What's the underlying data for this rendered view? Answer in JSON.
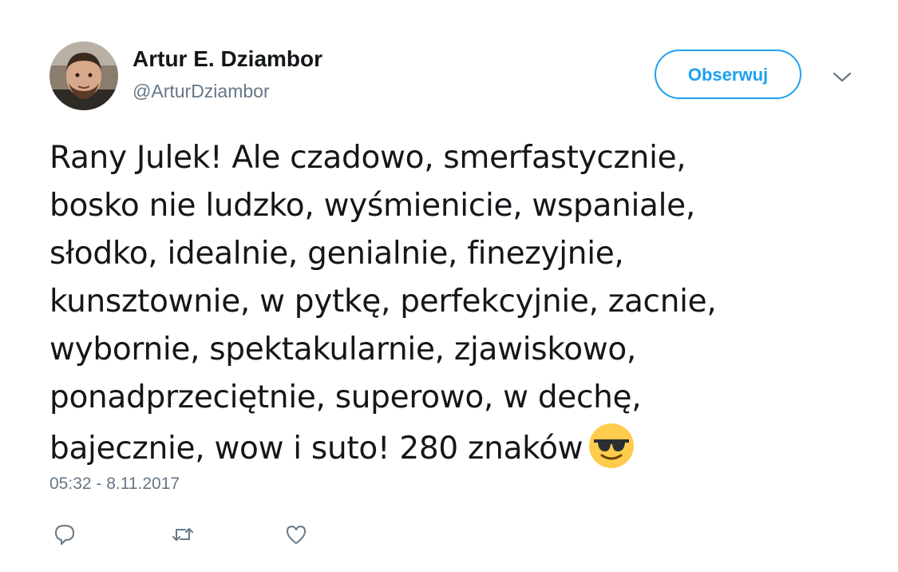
{
  "tweet": {
    "author": {
      "display_name": "Artur E. Dziambor",
      "handle": "@ArturDziambor",
      "avatar_icon": "profile-photo"
    },
    "follow_label": "Obserwuj",
    "text_lines": [
      "Rany Julek! Ale czadowo, smerfastycznie,",
      "bosko nie ludzko, wyśmienicie, wspaniale,",
      "słodko, idealnie, genialnie, finezyjnie,",
      "kunsztownie, w pytkę, perfekcyjnie, zacnie,",
      "wybornie, spektakularnie, zjawiskowo,",
      "ponadprzeciętnie, superowo, w dechę,",
      "bajecznie, wow i suto! 280 znaków"
    ],
    "emoji": "smiling-face-with-sunglasses",
    "timestamp": "05:32 - 8.11.2017",
    "actions": [
      "reply-icon",
      "retweet-icon",
      "like-icon"
    ]
  },
  "colors": {
    "accent": "#1da1f2",
    "text": "#14171a",
    "secondary_text": "#657786"
  }
}
